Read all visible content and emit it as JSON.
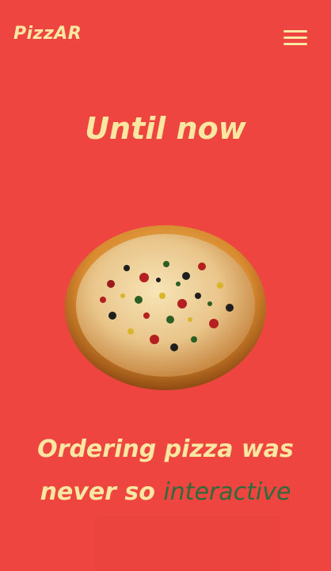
{
  "header": {
    "brand": "PizzAR",
    "menu_icon": "hamburger-menu-icon"
  },
  "hero": {
    "headline": "Until now",
    "image_icon": "pizza-image"
  },
  "tagline": {
    "line1": "Ordering pizza was",
    "line2_prefix": "never so ",
    "line2_accent": "interactive"
  },
  "colors": {
    "background": "#ee4540",
    "text": "#fbe7a1",
    "accent": "#2f6a3c"
  }
}
